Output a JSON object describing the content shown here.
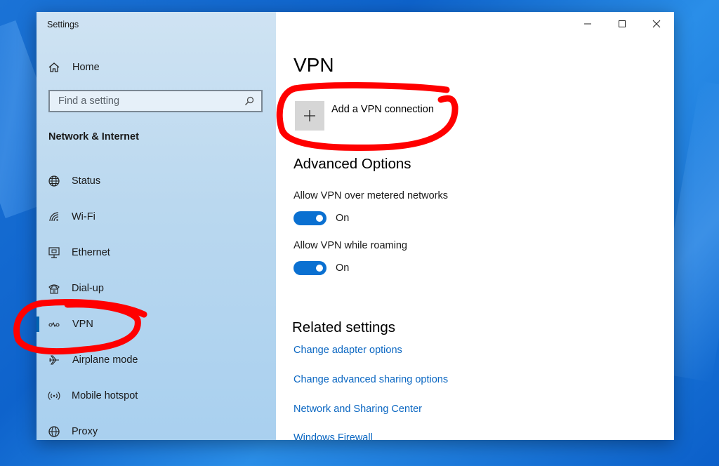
{
  "window": {
    "title": "Settings"
  },
  "sidebar": {
    "home_label": "Home",
    "search_placeholder": "Find a setting",
    "section_title": "Network & Internet",
    "items": [
      {
        "label": "Status",
        "icon": "globe-icon"
      },
      {
        "label": "Wi-Fi",
        "icon": "wifi-icon"
      },
      {
        "label": "Ethernet",
        "icon": "ethernet-icon"
      },
      {
        "label": "Dial-up",
        "icon": "phone-icon"
      },
      {
        "label": "VPN",
        "icon": "vpn-icon",
        "active": true
      },
      {
        "label": "Airplane mode",
        "icon": "airplane-icon"
      },
      {
        "label": "Mobile hotspot",
        "icon": "hotspot-icon"
      },
      {
        "label": "Proxy",
        "icon": "proxy-icon"
      }
    ]
  },
  "main": {
    "page_title": "VPN",
    "add_connection_label": "Add a VPN connection",
    "advanced_title": "Advanced Options",
    "options": [
      {
        "label": "Allow VPN over metered networks",
        "state": "On"
      },
      {
        "label": "Allow VPN while roaming",
        "state": "On"
      }
    ],
    "related_title": "Related settings",
    "links": [
      "Change adapter options",
      "Change advanced sharing options",
      "Network and Sharing Center",
      "Windows Firewall"
    ]
  },
  "colors": {
    "accent": "#0063b1",
    "toggle_on": "#0a70d1",
    "link": "#0b67c2",
    "annotation": "#ff0000"
  }
}
